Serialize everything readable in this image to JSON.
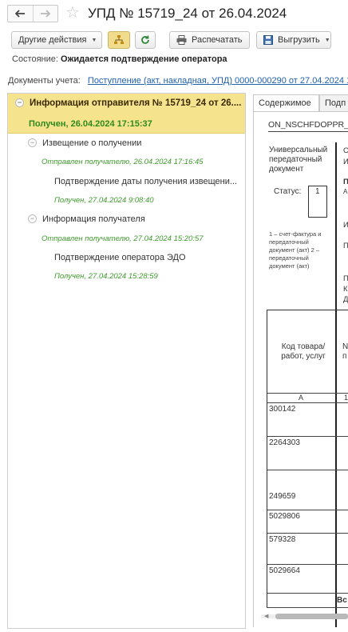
{
  "window": {
    "title": "УПД № 15719_24 от 26.04.2024"
  },
  "toolbar": {
    "other_actions": "Другие действия",
    "print": "Распечатать",
    "export": "Выгрузить"
  },
  "status": {
    "label": "Состояние:",
    "value": "Ожидается подтверждение оператора"
  },
  "accounting_docs": {
    "label": "Документы учета:",
    "link": "Поступление (акт, накладная, УПД) 0000-000290 от 27.04.2024 1"
  },
  "tree": {
    "root_title": "Информация отправителя № 15719_24 от 26....",
    "root_status": "Получен, 26.04.2024 17:15:37",
    "node1_title": "Извещение о получении",
    "node1_status": "Отправлен получателю, 26.04.2024 17:16:45",
    "node1_child_title": "Подтверждение даты получения извещени...",
    "node1_child_status": "Получен, 27.04.2024 9:08:40",
    "node2_title": "Информация получателя",
    "node2_status": "Отправлен получателю, 27.04.2024 15:20:57",
    "node2_child_title": "Подтверждение оператора ЭДО",
    "node2_child_status": "Получен, 27.04.2024 15:28:59"
  },
  "tabs": {
    "content": "Содержимое",
    "second": "Подп"
  },
  "document": {
    "file_name": "ON_NSCHFDOPPR_",
    "upd_title": "Универсальный передаточный документ",
    "status_label": "Статус:",
    "status_value": "1",
    "footnote": "1 – счет-фактура и передаточный документ (акт) 2 – передаточный документ (акт)",
    "right_chars": [
      "С",
      "И",
      "П",
      "А",
      "И",
      "П",
      "П",
      "К",
      "Д"
    ],
    "col_code_header": "Код товара/ работ, услуг",
    "col2_header_chars": [
      "N",
      "п"
    ],
    "col_letter": "А",
    "col2_letter": "1",
    "codes": [
      "300142",
      "2264303",
      "249659",
      "5029806",
      "579328",
      "5029664"
    ],
    "total_label": "Вс"
  },
  "colors": {
    "selected_row": "#f6e38e",
    "green_status": "#2f8a1e",
    "link": "#2161ae"
  }
}
